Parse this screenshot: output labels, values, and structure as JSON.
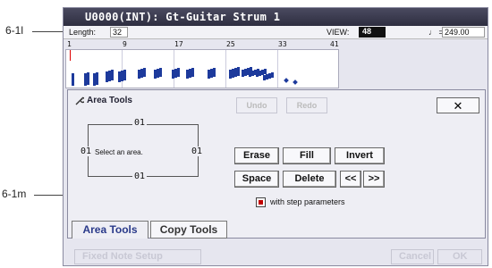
{
  "callouts": {
    "top": "6-1l",
    "mid": "6-1m"
  },
  "title": "U0000(INT): Gt-Guitar Strum 1",
  "length": {
    "label": "Length:",
    "value": "32"
  },
  "view": {
    "label": "VIEW:",
    "value": "48"
  },
  "tempo": {
    "label": "♩ =",
    "value": "249.00"
  },
  "ruler": [
    "1",
    "9",
    "17",
    "25",
    "33",
    "41"
  ],
  "panel": {
    "title": "Area Tools",
    "undo": "Undo",
    "redo": "Redo",
    "close": "✕",
    "select": {
      "top": "01",
      "left": "01",
      "right": "01",
      "bottom": "01",
      "hint": "Select an area."
    },
    "buttons": {
      "erase": "Erase",
      "fill": "Fill",
      "invert": "Invert",
      "space": "Space",
      "delete": "Delete",
      "shift_left": "<<",
      "shift_right": ">>"
    },
    "checkbox": {
      "label": "with step parameters",
      "checked": true
    },
    "tabs": [
      "Area Tools",
      "Copy Tools"
    ]
  },
  "footer": {
    "fixed_note_setup": "Fixed Note Setup",
    "cancel": "Cancel",
    "ok": "OK"
  },
  "colors": {
    "note": "#1d3a9c",
    "check": "#c00000",
    "title_bar": "#2e2e40"
  }
}
